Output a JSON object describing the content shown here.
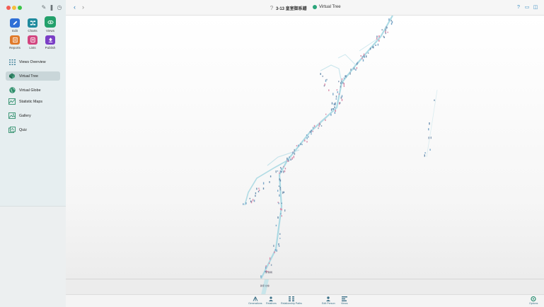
{
  "window": {
    "breadcrumb": "3-13 皇室御系譜",
    "title": "Virtual Tree",
    "nav_back": "‹",
    "nav_forward": "›"
  },
  "toolbar": [
    {
      "label": "Edit",
      "icon": "pencil-icon",
      "color": "#2f6fd6"
    },
    {
      "label": "Charts",
      "icon": "charts-icon",
      "color": "#1f8a9d"
    },
    {
      "label": "Views",
      "icon": "eye-icon",
      "color": "#22a06b"
    },
    {
      "label": "Reports",
      "icon": "reports-icon",
      "color": "#e07a2a"
    },
    {
      "label": "Lists",
      "icon": "lists-icon",
      "color": "#d2457f"
    },
    {
      "label": "Publish",
      "icon": "publish-icon",
      "color": "#7b3fc6"
    }
  ],
  "sidebar": {
    "items": [
      {
        "label": "Views Overview",
        "icon": "grid-icon"
      },
      {
        "label": "Virtual Tree",
        "icon": "tree-icon",
        "selected": true
      },
      {
        "label": "Virtual Globe",
        "icon": "globe-icon"
      },
      {
        "label": "Statistic Maps",
        "icon": "map-icon"
      },
      {
        "label": "Gallery",
        "icon": "gallery-icon"
      },
      {
        "label": "Quiz",
        "icon": "quiz-icon"
      }
    ]
  },
  "tree_labels": [
    "源 賴朝",
    "賴家 北條"
  ],
  "bottom_toolbar": [
    {
      "label": "Generations",
      "icon": "generations-icon"
    },
    {
      "label": "Relatives",
      "icon": "relatives-icon"
    },
    {
      "label": "Relationship Paths",
      "icon": "paths-icon"
    },
    {
      "label": "Edit Person",
      "icon": "person-icon"
    },
    {
      "label": "Views",
      "icon": "views-icon"
    },
    {
      "label": "Options",
      "icon": "gear-icon"
    }
  ]
}
